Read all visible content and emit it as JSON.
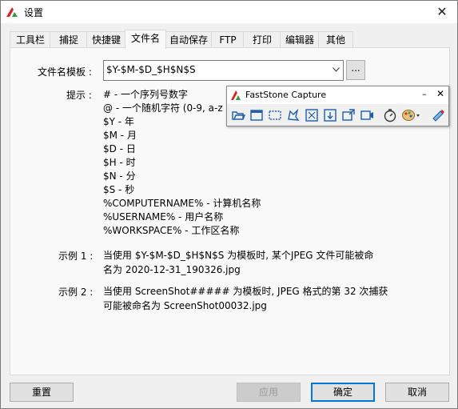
{
  "window": {
    "title": "设置",
    "close_glyph": "✕"
  },
  "tabs": [
    {
      "label": "工具栏"
    },
    {
      "label": "捕捉"
    },
    {
      "label": "快捷键"
    },
    {
      "label": "文件名",
      "active": true
    },
    {
      "label": "自动保存"
    },
    {
      "label": "FTP"
    },
    {
      "label": "打印"
    },
    {
      "label": "编辑器"
    },
    {
      "label": "其他"
    }
  ],
  "filename": {
    "label": "文件名模板 :",
    "template_value": "$Y-$M-$D_$H$N$S",
    "browse_label": "..."
  },
  "hints": {
    "label": "提示 :",
    "lines": [
      "#  - 一个序列号数字",
      "@  - 一个随机字符 (0-9, a-z",
      "$Y -  年",
      "$M -  月",
      "$D -  日",
      "$H -  时",
      "$N -  分",
      "$S -  秒",
      "%COMPUTERNAME% - 计算机名称",
      "%USERNAME% - 用户名称",
      "%WORKSPACE% - 工作区名称"
    ]
  },
  "example1": {
    "label": "示例 1 :",
    "line1": "当使用 $Y-$M-$D_$H$N$S 为模板时, 某个JPEG 文件可能被命",
    "line2": "名为 2020-12-31_190326.jpg"
  },
  "example2": {
    "label": "示例 2 :",
    "line1": "当使用 ScreenShot##### 为模板时, JPEG 格式的第 32 次捕获",
    "line2": "可能被命名为 ScreenShot00032.jpg"
  },
  "buttons": {
    "reset": "重置",
    "apply": "应用",
    "ok": "确定",
    "cancel": "取消"
  },
  "faststone": {
    "title": "FastStone Capture",
    "minimize_glyph": "–",
    "close_glyph": "✕",
    "tools": [
      "open-folder-icon",
      "capture-window-icon",
      "capture-rectangle-icon",
      "capture-freehand-icon",
      "capture-fullscreen-icon",
      "capture-scrolling-icon",
      "capture-fixed-region-icon",
      "screen-recorder-icon",
      "delay-timer-icon",
      "output-palette-icon",
      "settings-icon"
    ]
  },
  "colors": {
    "accent": "#0078d7",
    "faststone_red": "#d8262b",
    "faststone_green": "#2f9e3c"
  }
}
